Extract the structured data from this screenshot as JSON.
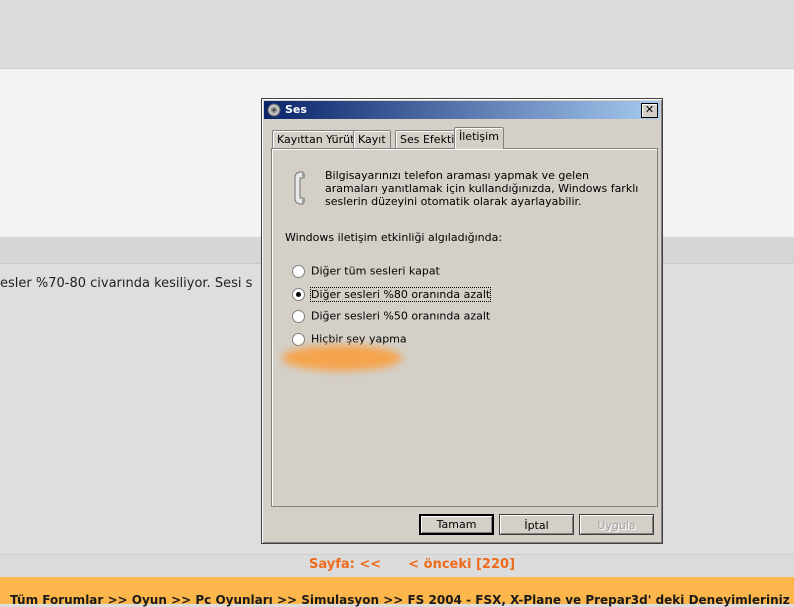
{
  "background": {
    "post_text": "esler %70-80 civarında kesiliyor. Sesi s",
    "pager": {
      "label": "Sayfa:",
      "first": "<<",
      "prev": "< önceki [220]"
    },
    "breadcrumb": "Tüm Forumlar >> Oyun >> Pc Oyunları >> Simulasyon >> FS 2004 - FSX, X-Plane ve Prepar3d' deki Deneyimleriniz"
  },
  "dialog": {
    "title": "Ses",
    "close_label": "✕",
    "tabs": [
      {
        "label": "Kayıttan Yürüt",
        "active": false
      },
      {
        "label": "Kayıt",
        "active": false
      },
      {
        "label": "Ses Efekti",
        "active": false
      },
      {
        "label": "İletişim",
        "active": true
      }
    ],
    "description": "Bilgisayarınızı telefon araması yapmak ve gelen aramaları yanıtlamak için kullandığınızda, Windows farklı seslerin düzeyini otomatik olarak ayarlayabilir.",
    "subheading": "Windows iletişim etkinliği algıladığında:",
    "options": [
      {
        "label": "Diğer tüm sesleri kapat",
        "checked": false
      },
      {
        "label": "Diğer sesleri %80 oranında azalt",
        "checked": true
      },
      {
        "label": "Diğer sesleri %50 oranında azalt",
        "checked": false
      },
      {
        "label": "Hiçbir şey yapma",
        "checked": false
      }
    ],
    "buttons": {
      "ok": "Tamam",
      "cancel": "İptal",
      "apply": "Uygula"
    }
  },
  "colors": {
    "titlebar_start": "#0a246a",
    "titlebar_end": "#a6caf0",
    "pager": "#ee6b1c",
    "footer_band": "#fdb64c"
  }
}
